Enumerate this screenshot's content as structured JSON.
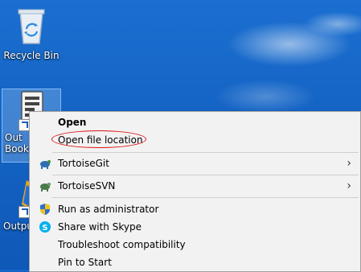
{
  "desktop": {
    "icons": [
      {
        "label": "Recycle Bin",
        "icon": "recycle-bin-icon"
      },
      {
        "label": "Out Books",
        "icon": "document-shortcut-icon"
      },
      {
        "label": "Output",
        "icon": "output-shortcut-icon"
      }
    ]
  },
  "context_menu": {
    "items": [
      {
        "label": "Open",
        "bold": true
      },
      {
        "label": "Open file location",
        "highlighted": true
      },
      {
        "label": "TortoiseGit",
        "icon": "tortoisegit-icon",
        "submenu": true
      },
      {
        "label": "TortoiseSVN",
        "icon": "tortoisesvn-icon",
        "submenu": true
      },
      {
        "label": "Run as administrator",
        "icon": "uac-shield-icon"
      },
      {
        "label": "Share with Skype",
        "icon": "skype-icon"
      },
      {
        "label": "Troubleshoot compatibility"
      },
      {
        "label": "Pin to Start"
      }
    ],
    "submenu_glyph": "›"
  },
  "colors": {
    "desktop_blue": "#1565c9",
    "menu_bg": "#f2f2f2",
    "annotation_red": "#d11111"
  }
}
